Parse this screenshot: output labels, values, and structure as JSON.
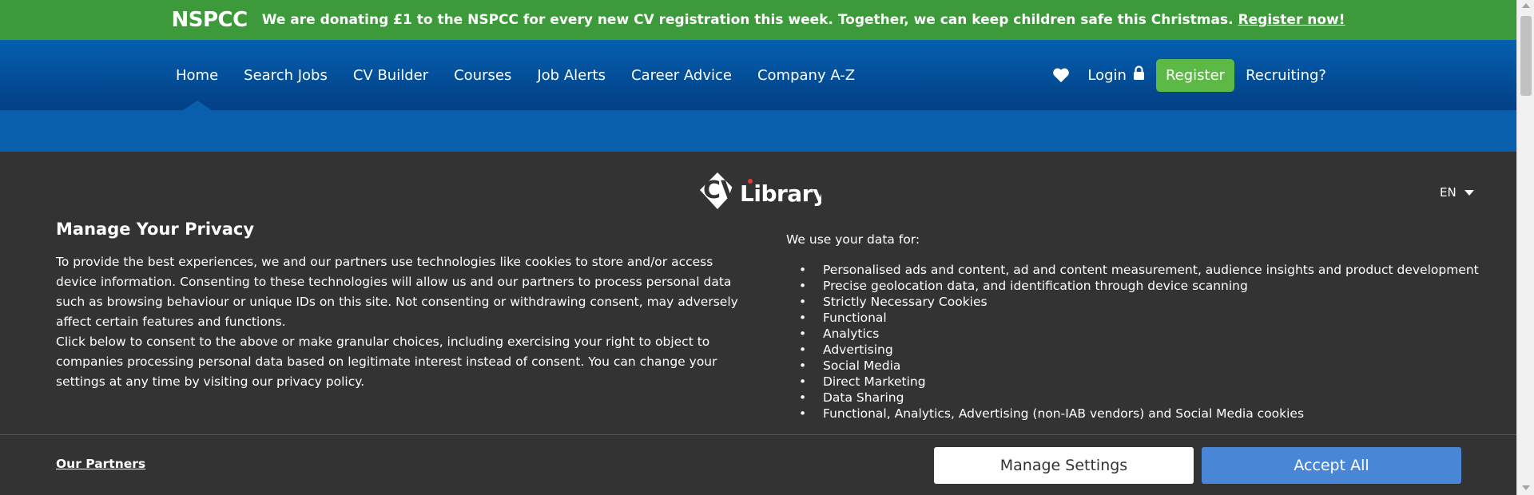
{
  "promo": {
    "logo_text": "NSPCC",
    "message": "We are donating £1 to the NSPCC for every new CV registration this week. Together, we can keep children safe this Christmas.",
    "link_label": "Register now!"
  },
  "nav": {
    "items": [
      {
        "label": "Home"
      },
      {
        "label": "Search Jobs"
      },
      {
        "label": "CV Builder"
      },
      {
        "label": "Courses"
      },
      {
        "label": "Job Alerts"
      },
      {
        "label": "Career Advice"
      },
      {
        "label": "Company A-Z"
      }
    ],
    "active": "Home",
    "heart_icon": "heart-icon",
    "login_label": "Login",
    "lock_icon": "lock-icon",
    "register_label": "Register",
    "recruiting_label": "Recruiting?"
  },
  "consent": {
    "brand": "CV Library",
    "language": "EN",
    "title": "Manage Your Privacy",
    "paragraph1": "To provide the best experiences, we and our partners use technologies like cookies to store and/or access device information. Consenting to these technologies will allow us and our partners to process personal data such as browsing behaviour or unique IDs on this site. Not consenting or withdrawing consent, may adversely affect certain features and functions.",
    "paragraph2": "Click below to consent to the above or make granular choices, including exercising your right to object to companies processing personal data based on legitimate interest instead of consent. You can change your settings at any time by visiting our privacy policy.",
    "uses_heading": "We use your data for:",
    "uses": [
      "Personalised ads and content, ad and content measurement, audience insights and product development",
      "Precise geolocation data, and identification through device scanning",
      "Strictly Necessary Cookies",
      "Functional",
      "Analytics",
      "Advertising",
      "Social Media",
      "Direct Marketing",
      "Data Sharing",
      "Functional, Analytics, Advertising (non-IAB vendors) and Social Media cookies"
    ],
    "partners_label": "Our Partners",
    "manage_label": "Manage Settings",
    "accept_label": "Accept All"
  },
  "colors": {
    "promo_bg": "#3c9a3a",
    "nav_bg": "#0460b0",
    "register_bg": "#5cb946",
    "consent_bg": "#333333",
    "accept_bg": "#4a86d6"
  }
}
